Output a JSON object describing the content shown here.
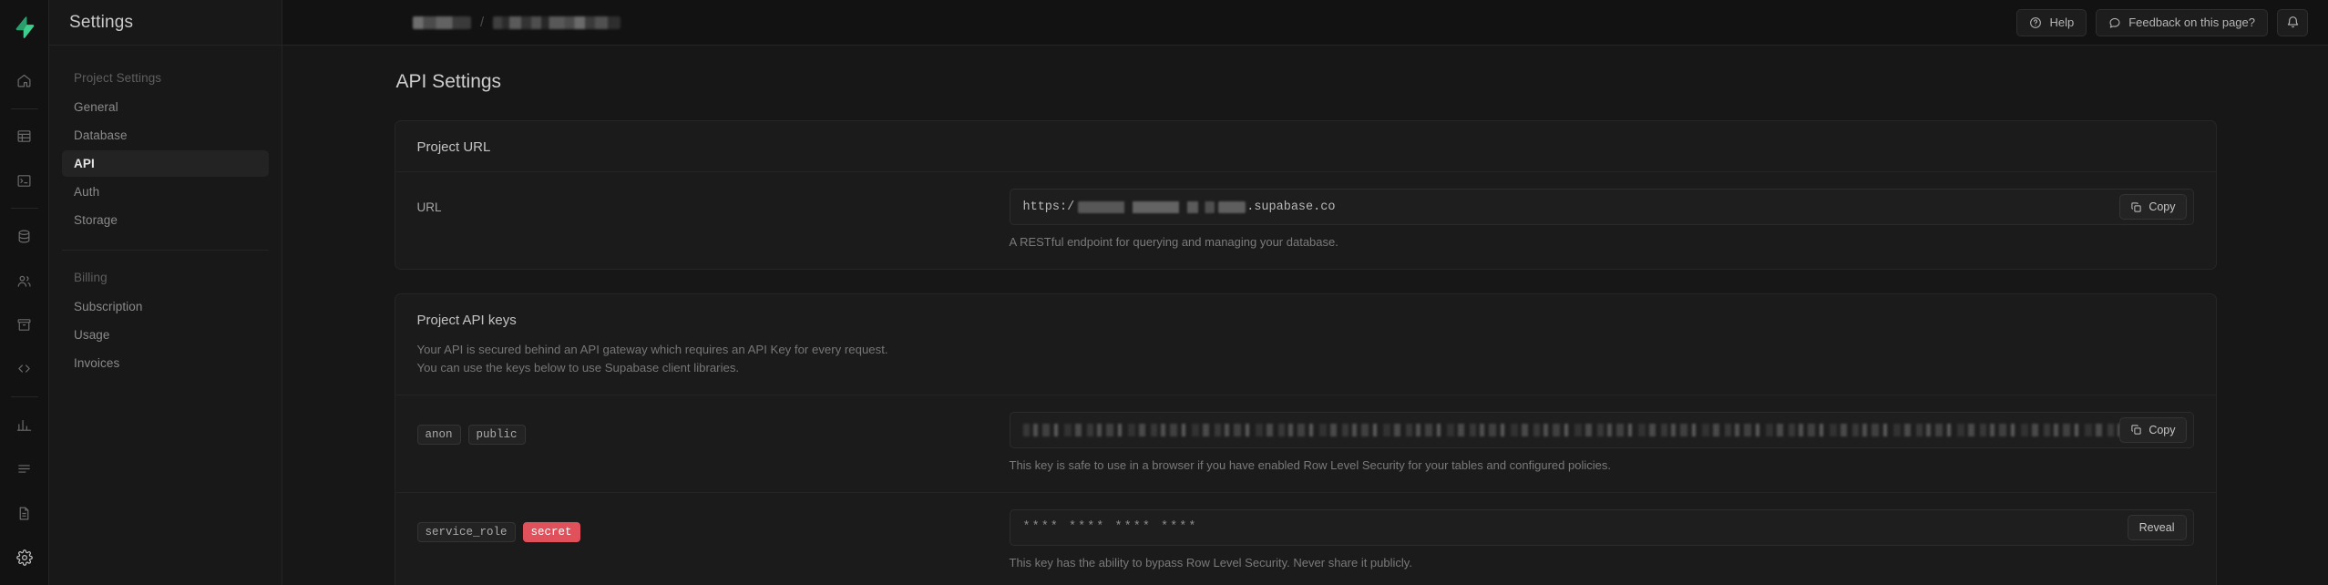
{
  "rail": {
    "logo_icon": "supabase-logo-icon",
    "logo_color": "#3ecf8e",
    "items": [
      {
        "icon": "home-icon",
        "name": "home"
      },
      {
        "icon": "table-editor-icon",
        "name": "table-editor"
      },
      {
        "icon": "sql-editor-icon",
        "name": "sql-editor"
      },
      {
        "icon": "database-icon",
        "name": "database"
      },
      {
        "icon": "authentication-icon",
        "name": "authentication"
      },
      {
        "icon": "storage-icon",
        "name": "storage"
      },
      {
        "icon": "edge-functions-icon",
        "name": "edge-functions"
      },
      {
        "icon": "reports-icon",
        "name": "reports"
      },
      {
        "icon": "logs-icon",
        "name": "logs"
      },
      {
        "icon": "api-docs-icon",
        "name": "api-docs"
      },
      {
        "icon": "settings-icon",
        "name": "settings"
      }
    ]
  },
  "sidebar": {
    "title": "Settings",
    "groups": [
      {
        "label": "Project Settings",
        "items": [
          {
            "label": "General",
            "active": false
          },
          {
            "label": "Database",
            "active": false
          },
          {
            "label": "API",
            "active": true
          },
          {
            "label": "Auth",
            "active": false
          },
          {
            "label": "Storage",
            "active": false
          }
        ]
      },
      {
        "label": "Billing",
        "items": [
          {
            "label": "Subscription",
            "active": false
          },
          {
            "label": "Usage",
            "active": false
          },
          {
            "label": "Invoices",
            "active": false
          }
        ]
      }
    ]
  },
  "topbar": {
    "breadcrumb_org_redacted": true,
    "breadcrumb_separator": "/",
    "breadcrumb_project_redacted": true,
    "help_label": "Help",
    "help_icon": "question-circle-icon",
    "feedback_label": "Feedback on this page?",
    "feedback_icon": "chat-bubble-icon",
    "notifications_icon": "bell-icon"
  },
  "page": {
    "title": "API Settings"
  },
  "project_url": {
    "heading": "Project URL",
    "row_label": "URL",
    "value_prefix": "https:/",
    "value_redacted": true,
    "value_suffix": ".supabase.co",
    "copy_label": "Copy",
    "copy_icon": "copy-icon",
    "help_text": "A RESTful endpoint for querying and managing your database."
  },
  "api_keys": {
    "heading": "Project API keys",
    "description_line1": "Your API is secured behind an API gateway which requires an API Key for every request.",
    "description_line2": "You can use the keys below to use Supabase client libraries.",
    "rows": [
      {
        "tags": [
          {
            "text": "anon",
            "style": "default"
          },
          {
            "text": "public",
            "style": "default"
          }
        ],
        "value_masked": false,
        "value": "",
        "action_label": "Copy",
        "action_icon": "copy-icon",
        "help_text": "This key is safe to use in a browser if you have enabled Row Level Security for your tables and configured policies."
      },
      {
        "tags": [
          {
            "text": "service_role",
            "style": "default"
          },
          {
            "text": "secret",
            "style": "danger"
          }
        ],
        "value_masked": true,
        "value": "**** **** **** ****",
        "action_label": "Reveal",
        "action_icon": "",
        "help_text": "This key has the ability to bypass Row Level Security. Never share it publicly."
      }
    ]
  },
  "colors": {
    "accent": "#3ecf8e",
    "danger": "#e0515b",
    "panel_bg": "#1b1b1b",
    "app_bg": "#171717"
  }
}
